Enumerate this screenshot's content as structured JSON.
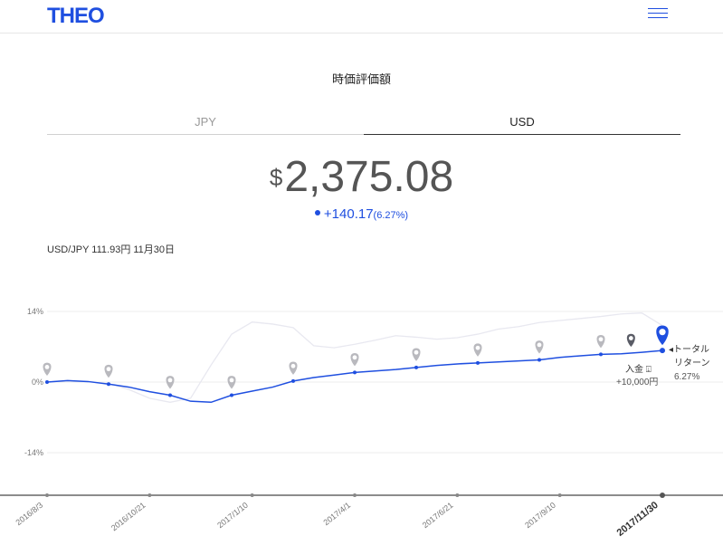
{
  "header": {
    "logo": "THEO",
    "menu_icon": "hamburger-menu-icon"
  },
  "title": "時価評価額",
  "tabs": [
    {
      "label": "JPY",
      "active": false
    },
    {
      "label": "USD",
      "active": true
    }
  ],
  "valuation": {
    "currency_symbol": "$",
    "amount": "2,375.08",
    "change": "+140.17",
    "change_pct": "(6.27%)"
  },
  "exchange_rate": "USD/JPY 111.93円 11月30日",
  "colors": {
    "accent": "#1f4fe0",
    "marker_gray": "#b9b9be",
    "marker_dark": "#5a5c66",
    "benchmark_line": "#e8e8f0"
  },
  "chart_data": {
    "type": "line",
    "ylabel_ticks": [
      "14%",
      "0%",
      "-14%"
    ],
    "ylim": [
      -14,
      14
    ],
    "x_labels": [
      "2016/8/3",
      "2016/10/21",
      "2017/1/10",
      "2017/4/1",
      "2017/6/21",
      "2017/9/10",
      "2017/11/30"
    ],
    "series": [
      {
        "name": "",
        "values": [
          0.0,
          0.3,
          0.1,
          -0.4,
          -1.0,
          -1.9,
          -2.6,
          -3.8,
          -4.0,
          -2.6,
          -1.8,
          -1.0,
          0.2,
          0.9,
          1.4,
          1.9,
          2.2,
          2.5,
          2.9,
          3.3,
          3.6,
          3.8,
          4.0,
          4.2,
          4.4,
          4.9,
          5.2,
          5.5,
          5.6,
          5.9,
          6.27
        ]
      },
      {
        "name": "",
        "values": [
          0.0,
          0.3,
          0.1,
          -0.3,
          -1.5,
          -3.2,
          -4.0,
          -3.2,
          3.4,
          9.5,
          11.9,
          11.5,
          10.8,
          7.2,
          6.8,
          7.5,
          8.3,
          9.2,
          8.9,
          8.5,
          8.8,
          9.5,
          10.5,
          11.0,
          11.8,
          12.2,
          12.6,
          13.0,
          13.5,
          13.7,
          11.2
        ]
      }
    ],
    "annotations": {
      "deposit_label": "入金",
      "deposit_amount": "+10,000円",
      "total_return_label_1": "トータル",
      "total_return_label_2": "リターン",
      "total_return_value": "6.27%"
    }
  }
}
